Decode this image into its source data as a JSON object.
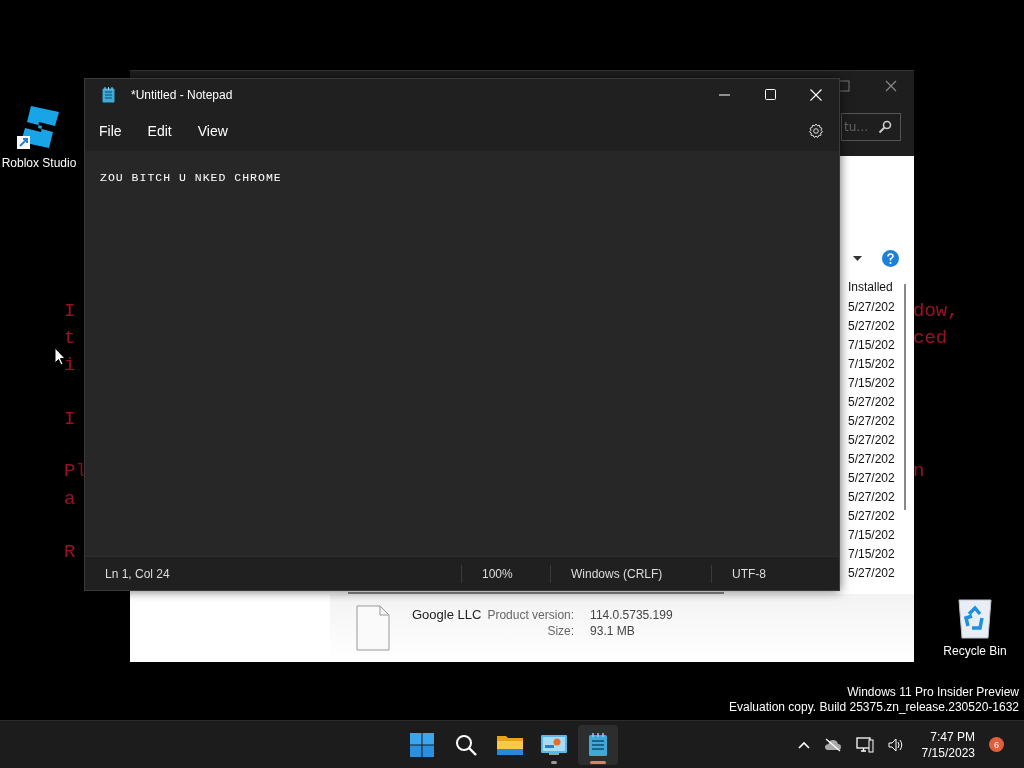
{
  "desktop": {
    "icons": [
      {
        "kind": "roblox",
        "label": "Roblox Studio"
      },
      {
        "kind": "recycle",
        "label": "Recycle Bin"
      }
    ],
    "background_text": {
      "left": [
        "I",
        "t",
        "i",
        "I",
        "Pl",
        "a",
        "R"
      ],
      "right": [
        "dow,",
        "ced",
        "n"
      ]
    },
    "watermark": [
      "Windows 11 Pro Insider Preview",
      "Evaluation copy. Build 25375.zn_release.230520-1632"
    ]
  },
  "programs_window": {
    "search": {
      "placeholder": "tu…"
    },
    "column_header": "Installed",
    "rows": [
      "5/27/202",
      "5/27/202",
      "7/15/202",
      "7/15/202",
      "7/15/202",
      "5/27/202",
      "5/27/202",
      "5/27/202",
      "5/27/202",
      "5/27/202",
      "5/27/202",
      "5/27/202",
      "7/15/202",
      "7/15/202",
      "5/27/202"
    ],
    "details": {
      "publisher": "Google LLC",
      "fields": [
        {
          "label": "Product version:",
          "value": "114.0.5735.199"
        },
        {
          "label": "Size:",
          "value": "93.1 MB"
        }
      ]
    }
  },
  "notepad": {
    "title": "*Untitled - Notepad",
    "menu": [
      "File",
      "Edit",
      "View"
    ],
    "text": "ZOU BITCH U NKED CHROME",
    "status": [
      {
        "text": "Ln 1, Col 24"
      },
      {
        "text": "100%"
      },
      {
        "text": "Windows (CRLF)"
      },
      {
        "text": "UTF-8"
      }
    ]
  },
  "taskbar": {
    "apps": [
      {
        "kind": "start",
        "selected": false
      },
      {
        "kind": "search",
        "selected": false
      },
      {
        "kind": "explorer",
        "selected": false
      },
      {
        "kind": "control",
        "selected": false,
        "running": true
      },
      {
        "kind": "notepad",
        "selected": true,
        "running": true
      }
    ],
    "time": "7:47 PM",
    "date": "7/15/2023",
    "badge": "6"
  }
}
